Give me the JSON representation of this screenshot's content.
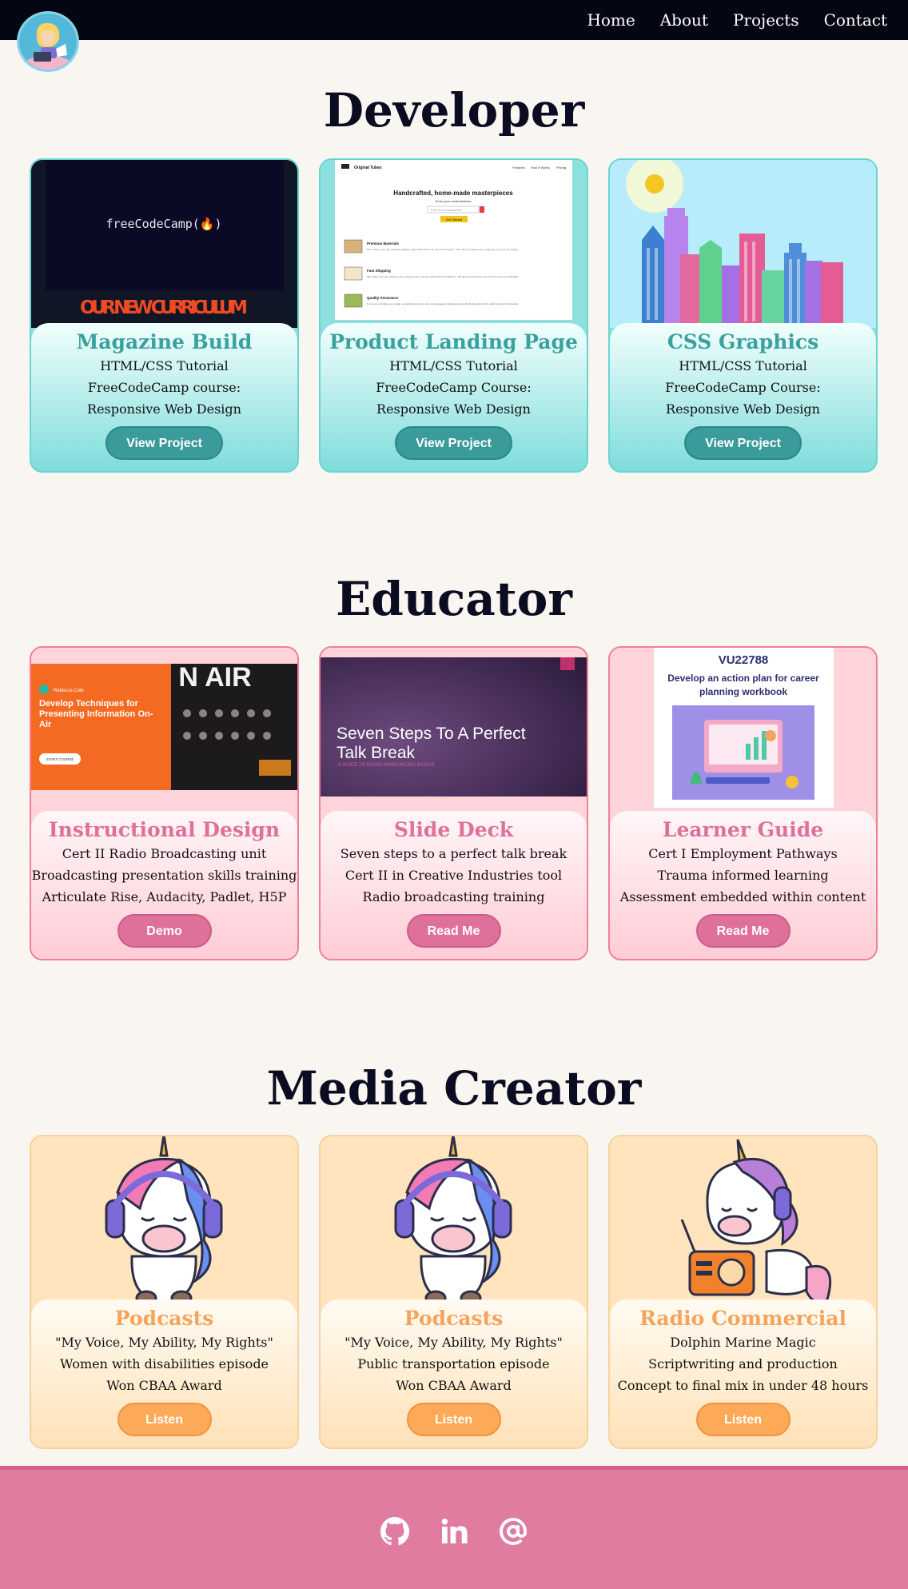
{
  "nav": {
    "items": [
      "Home",
      "About",
      "Projects",
      "Contact"
    ]
  },
  "sections": {
    "developer": {
      "title": "Developer",
      "cards": [
        {
          "title": "Magazine Build",
          "lines": [
            "HTML/CSS Tutorial",
            "FreeCodeCamp course:",
            "Responsive Web Design"
          ],
          "button": "View Project",
          "media_text": {
            "brand": "freeCodeCamp(🔥)",
            "banner": "OUR NEW CURRICULUM"
          }
        },
        {
          "title": "Product Landing Page",
          "lines": [
            "HTML/CSS Tutorial",
            "FreeCodeCamp Course:",
            "Responsive Web Design"
          ],
          "button": "View Project",
          "media_text": {
            "brand": "Original Tubes",
            "nav": [
              "Features",
              "How It Works",
              "Pricing"
            ],
            "heading": "Handcrafted, home-made masterpieces",
            "sub": "Enter your email address",
            "input": "Enter your email address",
            "cta": "Get Started",
            "features": [
              {
                "title": "Premium Materials",
                "desc": "Our tubes use the highest quality materials which is sourced locally. This will increase the longevity of your purchase."
              },
              {
                "title": "Fast Shipping",
                "desc": "We make sure you receive your tubes as soon as we have finished making it. We also provide free returns if you are not satisfied."
              },
              {
                "title": "Quality Assurance",
                "desc": "For every purchase you make, we will ensure there are no damaged or faults and we will check and test the pitch of your instruments."
              }
            ]
          }
        },
        {
          "title": "CSS Graphics",
          "lines": [
            "HTML/CSS Tutorial",
            "FreeCodeCamp Course:",
            "Responsive Web Design"
          ],
          "button": "View Project"
        }
      ]
    },
    "educator": {
      "title": "Educator",
      "cards": [
        {
          "title": "Instructional Design",
          "lines": [
            "Cert II Radio Broadcasting unit",
            "Broadcasting presentation skills training",
            "Articulate Rise, Audacity, Padlet, H5P"
          ],
          "button": "Demo",
          "media_text": {
            "author": "Rebecca Cole",
            "heading": "Develop Techniques for Presenting Information On-Air",
            "cta": "START COURSE",
            "sign": "N AIR"
          }
        },
        {
          "title": "Slide Deck",
          "lines": [
            "Seven steps to a perfect talk break",
            "Cert II in Creative Industries tool",
            "Radio broadcasting training"
          ],
          "button": "Read Me",
          "media_text": {
            "heading": "Seven Steps To A Perfect Talk Break",
            "sub": "A GUIDE TO RADIO ANNOUNCING BASICS"
          }
        },
        {
          "title": "Learner Guide",
          "lines": [
            "Cert I Employment Pathways",
            "Trauma informed learning",
            "Assessment embedded within content"
          ],
          "button": "Read Me",
          "media_text": {
            "code": "VU22788",
            "heading": "Develop an action plan for career planning workbook"
          }
        }
      ]
    },
    "media": {
      "title": "Media Creator",
      "cards": [
        {
          "title": "Podcasts",
          "lines": [
            "\"My Voice, My Ability, My Rights\"",
            "Women with disabilities episode",
            "Won CBAA Award"
          ],
          "button": "Listen"
        },
        {
          "title": "Podcasts",
          "lines": [
            "\"My Voice, My Ability, My Rights\"",
            "Public transportation episode",
            "Won CBAA Award"
          ],
          "button": "Listen"
        },
        {
          "title": "Radio Commercial",
          "lines": [
            "Dolphin Marine Magic",
            "Scriptwriting and production",
            "Concept to final mix in under 48 hours"
          ],
          "button": "Listen"
        }
      ]
    }
  },
  "footer": {
    "icons": [
      "github-icon",
      "linkedin-icon",
      "email-at-icon"
    ]
  },
  "colors": {
    "nav_bg": "#050613",
    "page_bg": "#f9f6f1",
    "teal": "#3a9b9a",
    "pink": "#df7099",
    "orange": "#fdaa58",
    "footer_bg": "#e07ca0"
  }
}
